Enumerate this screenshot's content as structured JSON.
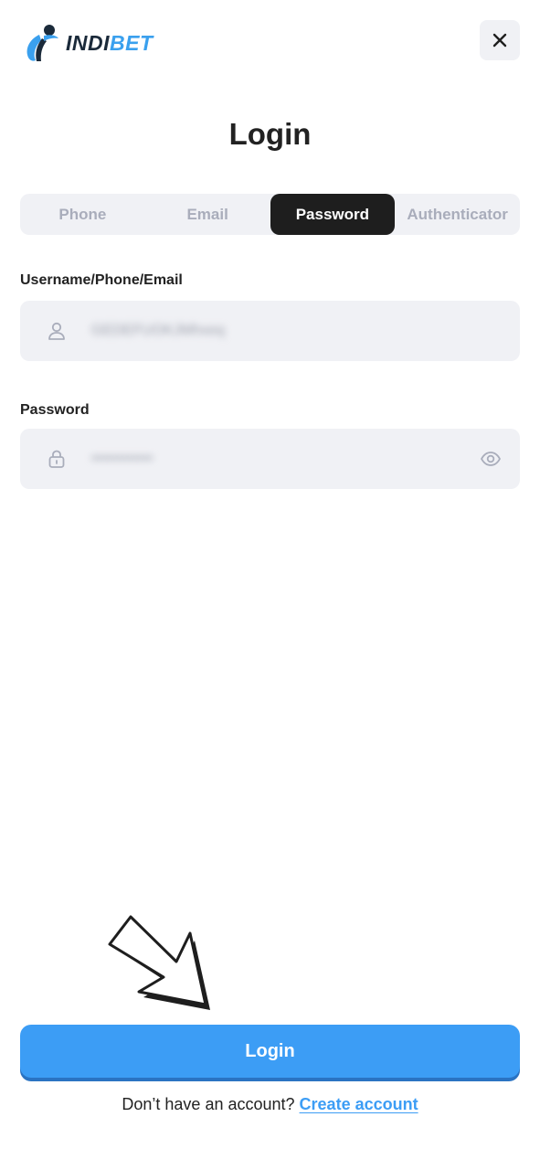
{
  "header": {
    "logo_text_part1": "INDI",
    "logo_text_part2": "BET",
    "close_label": "close"
  },
  "title": "Login",
  "tabs": [
    {
      "label": "Phone",
      "active": false
    },
    {
      "label": "Email",
      "active": false
    },
    {
      "label": "Password",
      "active": true
    },
    {
      "label": "Authenticator",
      "active": false
    }
  ],
  "form": {
    "username_label": "Username/Phone/Email",
    "username_value": "GEDEFUOKJMhxeq",
    "password_label": "Password",
    "password_value": "••••••••••••"
  },
  "login_button": "Login",
  "signup": {
    "prompt": "Don’t have an account?",
    "link": "Create account"
  },
  "colors": {
    "accent": "#3c9df5",
    "tab_active_bg": "#1e1e1e",
    "field_bg": "#f0f1f5"
  },
  "icons": [
    "logo-mark-icon",
    "close-icon",
    "user-icon",
    "lock-icon",
    "eye-icon",
    "arrow-pointer-icon"
  ]
}
